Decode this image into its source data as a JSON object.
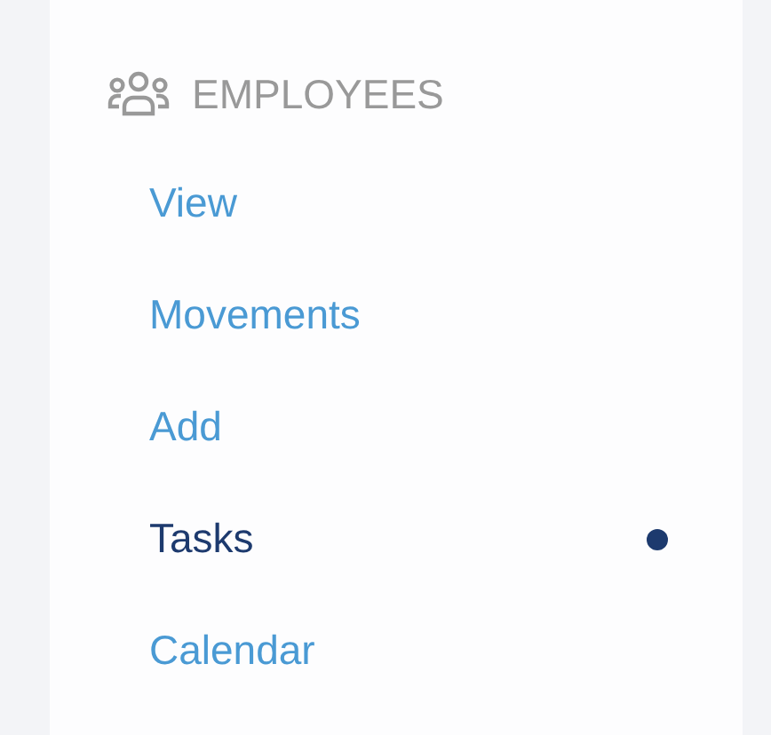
{
  "section": {
    "title": "EMPLOYEES"
  },
  "items": [
    {
      "label": "View",
      "selected": false
    },
    {
      "label": "Movements",
      "selected": false
    },
    {
      "label": "Add",
      "selected": false
    },
    {
      "label": "Tasks",
      "selected": true
    },
    {
      "label": "Calendar",
      "selected": false
    }
  ]
}
